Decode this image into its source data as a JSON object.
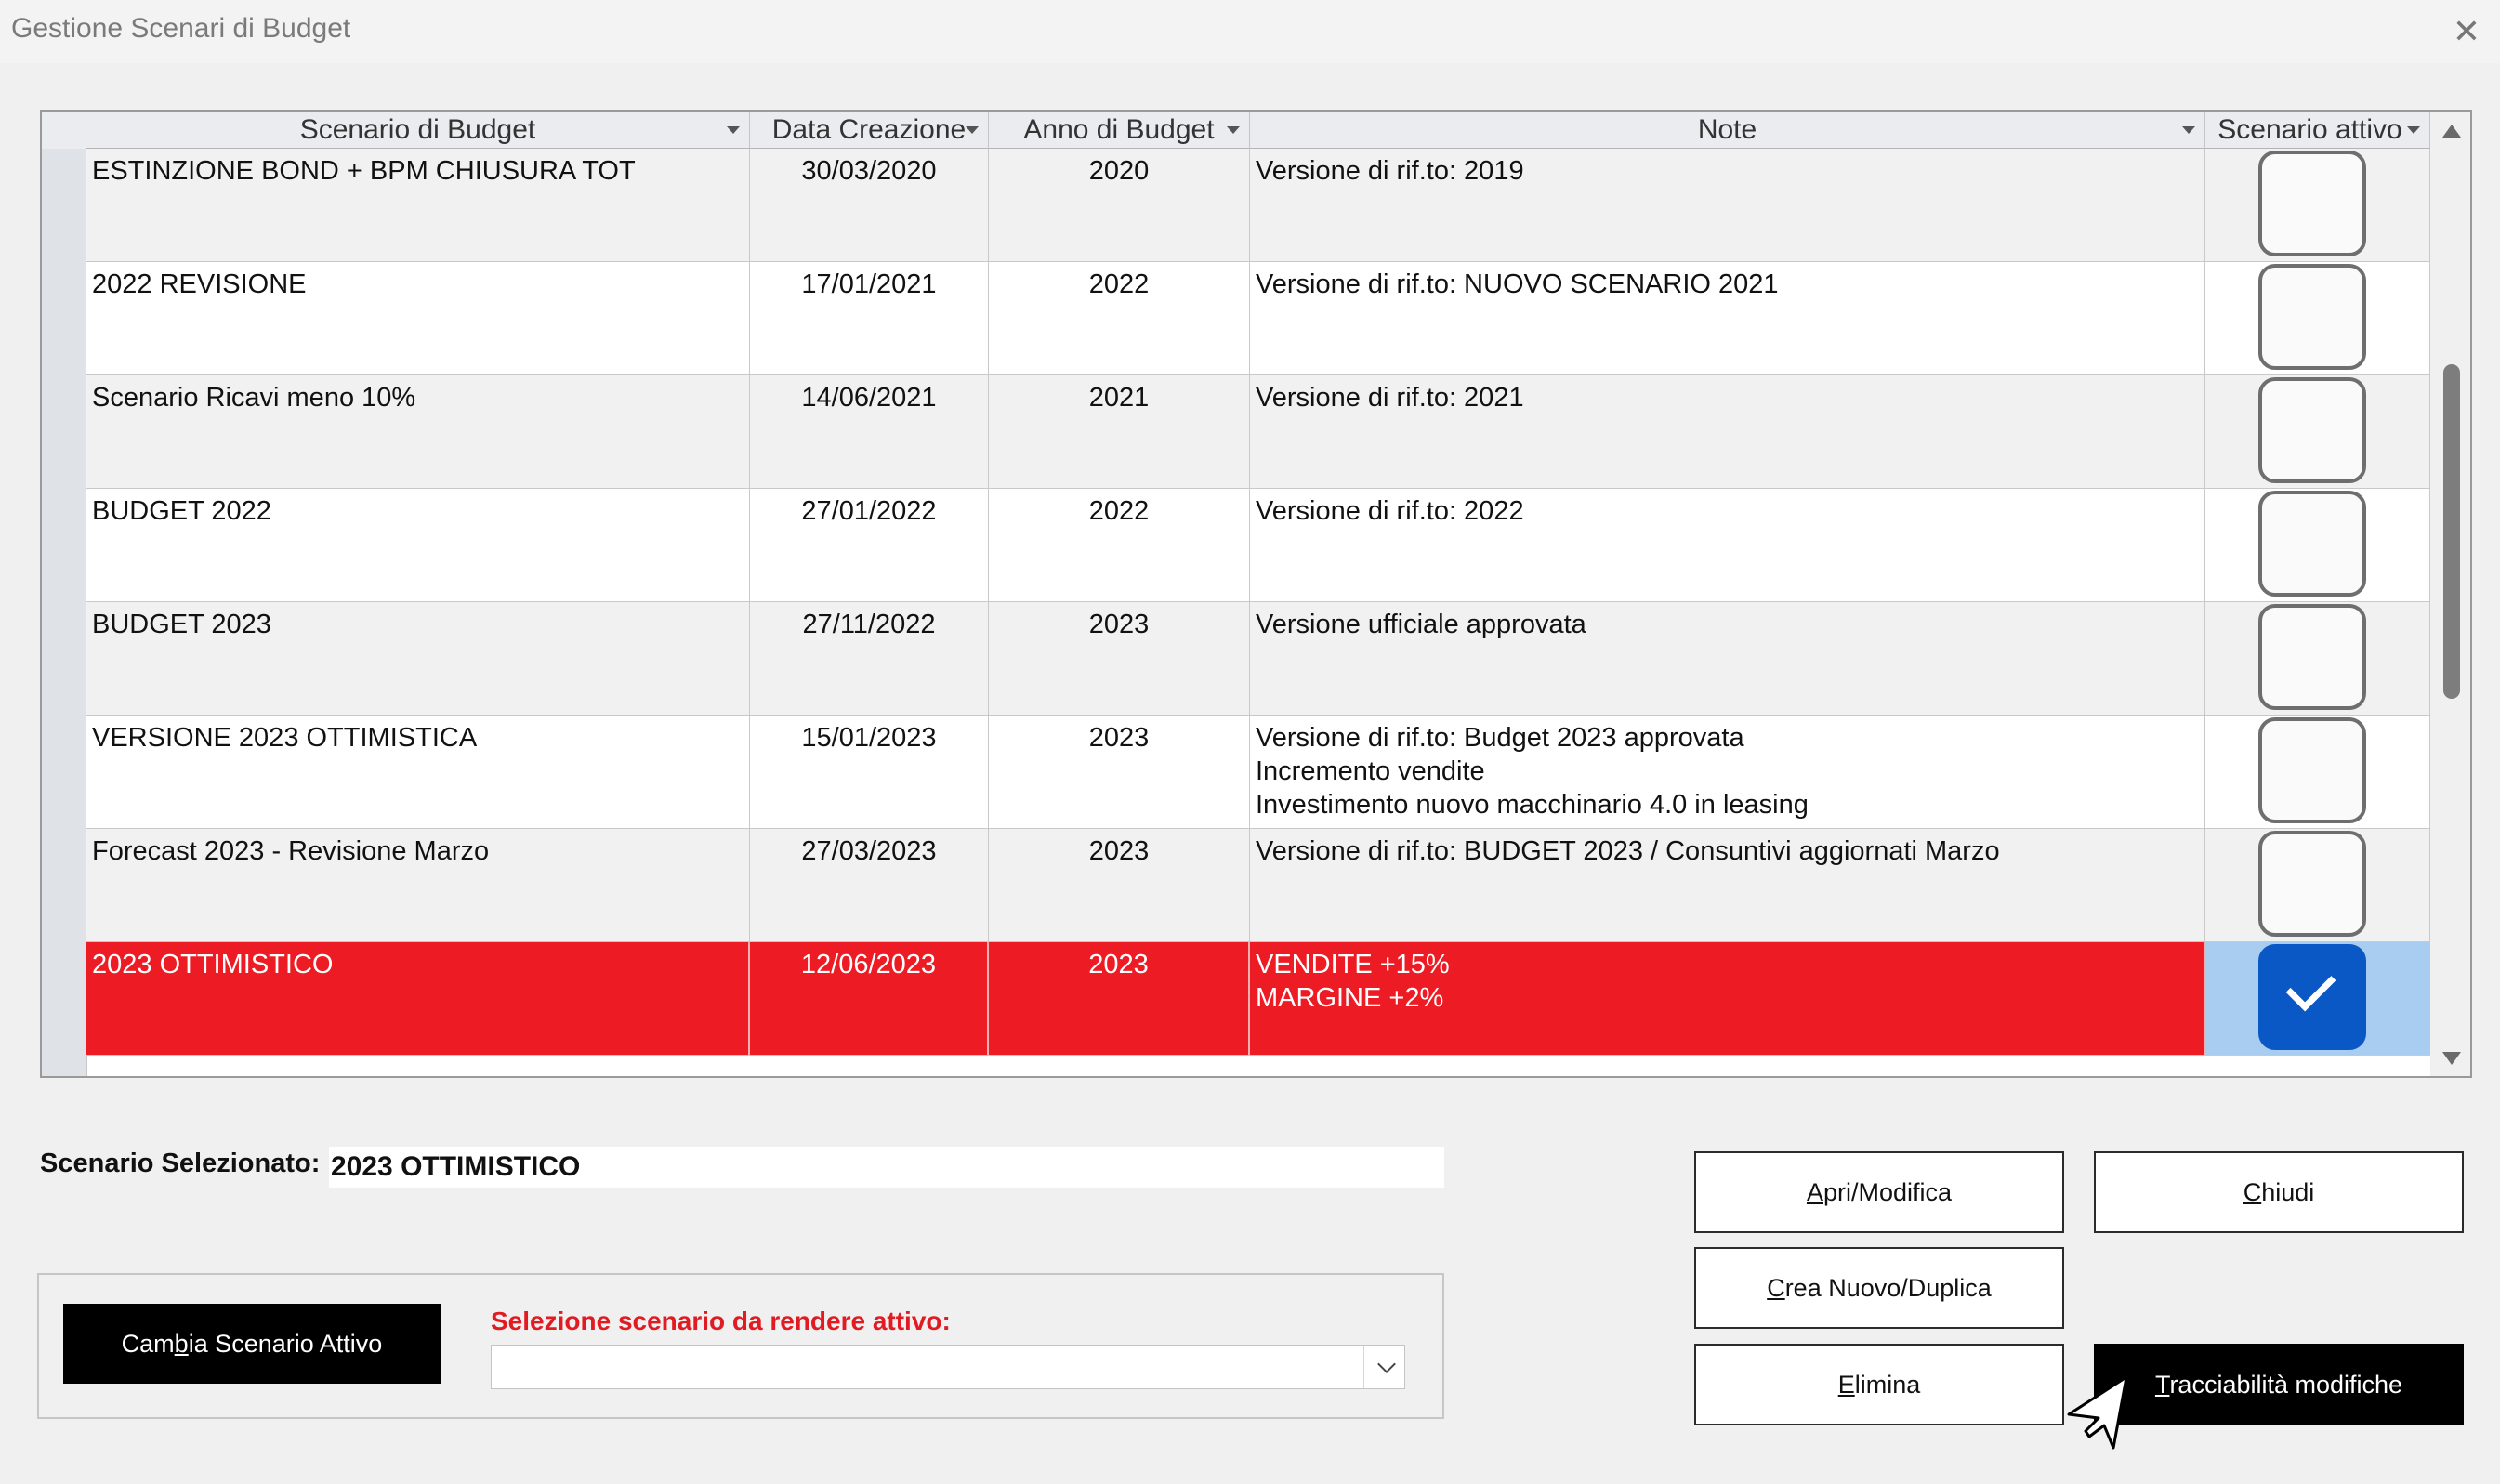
{
  "window": {
    "title": "Gestione Scenari di Budget"
  },
  "grid": {
    "columns": [
      "Scenario di Budget",
      "Data Creazione",
      "Anno di Budget",
      "Note",
      "Scenario attivo"
    ],
    "rows": [
      {
        "scenario": "ESTINZIONE BOND + BPM CHIUSURA TOT",
        "data": "30/03/2020",
        "anno": "2020",
        "note": "Versione di rif.to: 2019",
        "attivo": false
      },
      {
        "scenario": "2022 REVISIONE",
        "data": "17/01/2021",
        "anno": "2022",
        "note": "Versione di rif.to: NUOVO SCENARIO 2021",
        "attivo": false
      },
      {
        "scenario": "Scenario Ricavi meno 10%",
        "data": "14/06/2021",
        "anno": "2021",
        "note": "Versione di rif.to: 2021",
        "attivo": false
      },
      {
        "scenario": "BUDGET 2022",
        "data": "27/01/2022",
        "anno": "2022",
        "note": "Versione di rif.to: 2022",
        "attivo": false
      },
      {
        "scenario": "BUDGET 2023",
        "data": "27/11/2022",
        "anno": "2023",
        "note": "Versione ufficiale approvata",
        "attivo": false
      },
      {
        "scenario": "VERSIONE 2023 OTTIMISTICA",
        "data": "15/01/2023",
        "anno": "2023",
        "note": "Versione di rif.to: Budget 2023 approvata\nIncremento vendite\nInvestimento nuovo macchinario 4.0 in leasing",
        "attivo": false
      },
      {
        "scenario": "Forecast 2023 - Revisione Marzo",
        "data": "27/03/2023",
        "anno": "2023",
        "note": "Versione di rif.to: BUDGET 2023 / Consuntivi aggiornati Marzo",
        "attivo": false
      },
      {
        "scenario": "2023 OTTIMISTICO",
        "data": "12/06/2023",
        "anno": "2023",
        "note": "VENDITE +15%\nMARGINE +2%",
        "attivo": true,
        "selected": true
      }
    ]
  },
  "selected": {
    "label": "Scenario Selezionato:",
    "value": "2023 OTTIMISTICO"
  },
  "activate": {
    "button_pre": "Cam",
    "button_acc": "b",
    "button_post": "ia Scenario Attivo",
    "select_label": "Selezione scenario da rendere attivo:",
    "select_value": ""
  },
  "buttons": {
    "apri": {
      "pre": "",
      "acc": "A",
      "post": "pri/Modifica"
    },
    "chiudi": {
      "pre": "",
      "acc": "C",
      "post": "hiudi"
    },
    "crea": {
      "pre": "",
      "acc": "C",
      "post": "rea Nuovo/Duplica"
    },
    "elimina": {
      "pre": "",
      "acc": "E",
      "post": "limina"
    },
    "tracciabilita": {
      "pre": "",
      "acc": "T",
      "post": "racciabilità modifiche"
    }
  },
  "colors": {
    "selected_row": "#ed1c24",
    "active_check": "#0a58c6",
    "label_red": "#e11b22"
  }
}
